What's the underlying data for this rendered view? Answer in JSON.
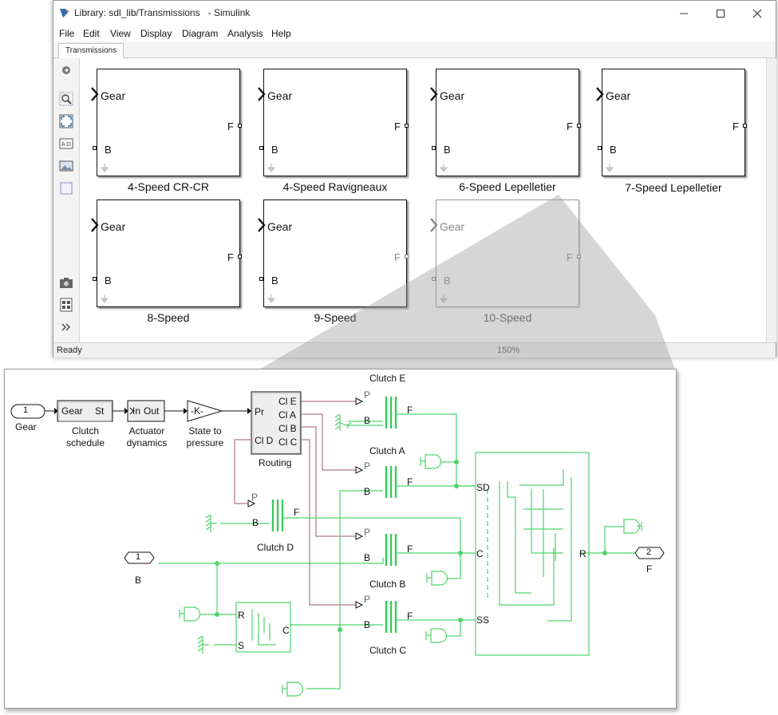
{
  "window": {
    "title": "Library: sdl_lib/Transmissions   - Simulink",
    "menu": [
      "File",
      "Edit",
      "View",
      "Display",
      "Diagram",
      "Analysis",
      "Help"
    ],
    "tab": "Transmissions",
    "status": "Ready",
    "zoom": "150%"
  },
  "library_blocks": [
    {
      "gear_port": "Gear",
      "b_port": "B",
      "f_port": "F",
      "caption": "4-Speed CR-CR"
    },
    {
      "gear_port": "Gear",
      "b_port": "B",
      "f_port": "F",
      "caption": "4-Speed Ravigneaux"
    },
    {
      "gear_port": "Gear",
      "b_port": "B",
      "f_port": "F",
      "caption": "6-Speed Lepelletier"
    },
    {
      "gear_port": "Gear",
      "b_port": "B",
      "f_port": "F",
      "caption": "7-Speed Lepelletier"
    },
    {
      "gear_port": "Gear",
      "b_port": "B",
      "f_port": "F",
      "caption": "8-Speed"
    },
    {
      "gear_port": "Gear",
      "b_port": "B",
      "f_port": "F",
      "caption": "9-Speed"
    },
    {
      "gear_port": "Gear",
      "b_port": "B",
      "f_port": "F",
      "caption": "10-Speed"
    }
  ],
  "detail": {
    "inport_gear": {
      "number": "1",
      "label": "Gear"
    },
    "clutch_schedule": {
      "in": "Gear",
      "out": "St",
      "caption": "Clutch\nschedule"
    },
    "actuator": {
      "in": "In",
      "out": "Out",
      "caption": "Actuator\ndynamics"
    },
    "gain": {
      "text": "-K-",
      "caption": "State to\npressure"
    },
    "routing": {
      "in": "Pr",
      "in2": "Cl D",
      "outs": [
        "Cl E",
        "Cl A",
        "Cl B",
        "Cl C"
      ],
      "caption": "Routing"
    },
    "clutches": [
      {
        "name": "Clutch E",
        "p": "P",
        "b": "B",
        "f": "F"
      },
      {
        "name": "Clutch A",
        "p": "P",
        "b": "B",
        "f": "F"
      },
      {
        "name": "Clutch D",
        "p": "P",
        "b": "B",
        "f": "F"
      },
      {
        "name": "Clutch B",
        "p": "P",
        "b": "B",
        "f": "F"
      },
      {
        "name": "Clutch C",
        "p": "P",
        "b": "B",
        "f": "F"
      }
    ],
    "planetary_ports": {
      "sd": "SD",
      "c": "C",
      "ss": "SS",
      "r": "R"
    },
    "small_block_ports": {
      "r": "R",
      "s": "S",
      "c": "C"
    },
    "inport_b": {
      "number": "1",
      "label": "B"
    },
    "outport_f": {
      "number": "2",
      "label": "F"
    }
  },
  "colors": {
    "physical": "#4dd36a",
    "signal": "#111111",
    "routing": "#9b5a66"
  }
}
